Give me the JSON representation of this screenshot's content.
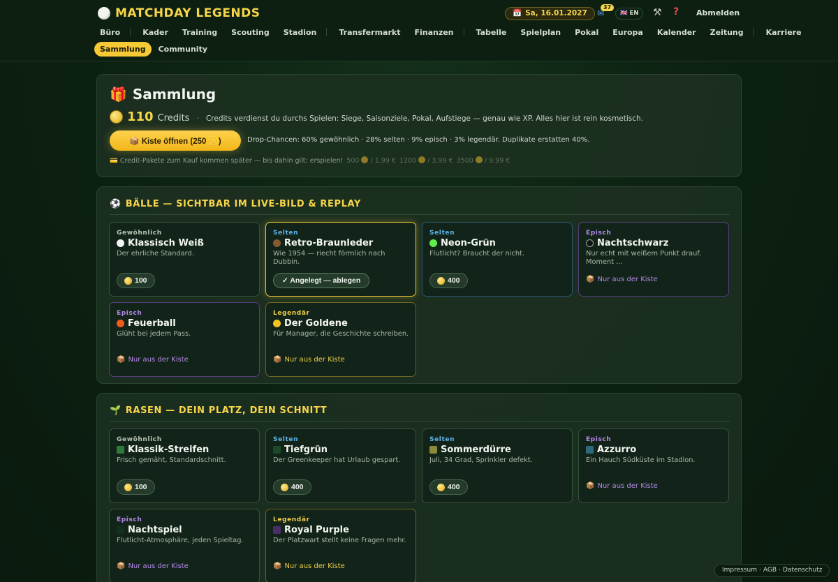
{
  "header": {
    "app_title": "MATCHDAY LEGENDS",
    "date": "Sa, 16.01.2027",
    "mail_count": "37",
    "language": "EN",
    "logout": "Abmelden",
    "nav": [
      "Büro",
      "Kader",
      "Training",
      "Scouting",
      "Stadion",
      "Transfermarkt",
      "Finanzen",
      "Tabelle",
      "Spielplan",
      "Pokal",
      "Europa",
      "Kalender",
      "Zeitung",
      "Karriere"
    ],
    "nav2_active": "Sammlung",
    "nav2_other": "Community"
  },
  "summary": {
    "title": "Sammlung",
    "credits": "110",
    "credits_unit": "Credits",
    "credits_note": "Credits verdienst du durchs Spielen: Siege, Saisonziele, Pokal, Aufstiege — genau wie XP. Alles hier ist rein kosmetisch.",
    "open_button": "📦 Kiste öffnen (250 🪙)",
    "drop_info": "Drop-Chancen: 60% gewöhnlich · 28% selten · 9% episch · 3% legendär. Duplikate erstatten 40%.",
    "packs_note": "💳 Credit-Pakete zum Kauf kommen später — bis dahin gilt: erspielen!",
    "packs": [
      {
        "amount": "500",
        "price": "/ 1,99 €"
      },
      {
        "amount": "1200",
        "price": "/ 3,99 €"
      },
      {
        "amount": "3500",
        "price": "/ 9,99 €"
      }
    ]
  },
  "balls": {
    "title": "BÄLLE — SICHTBAR IM LIVE-BILD & REPLAY",
    "items": [
      {
        "rarity": "Gewöhnlich",
        "name": "Klassisch Weiß",
        "desc": "Der ehrliche Standard.",
        "price": "100",
        "color": "#f4f4f0"
      },
      {
        "rarity": "Selten",
        "name": "Retro-Braunleder",
        "desc": "Wie 1954 — riecht förmlich nach Dubbin.",
        "equipped_label": "✓ Angelegt — ablegen",
        "color": "#8a5a2e"
      },
      {
        "rarity": "Selten",
        "name": "Neon-Grün",
        "desc": "Flutlicht? Braucht der nicht.",
        "price": "400",
        "color": "#5ef04a"
      },
      {
        "rarity": "Episch",
        "name": "Nachtschwarz",
        "desc": "Nur echt mit weißem Punkt drauf. Moment …",
        "crate_label": "Nur aus der Kiste",
        "color": "#111411"
      },
      {
        "rarity": "Episch",
        "name": "Feuerball",
        "desc": "Glüht bei jedem Pass.",
        "crate_label": "Nur aus der Kiste",
        "color": "#f05a1e"
      },
      {
        "rarity": "Legendär",
        "name": "Der Goldene",
        "desc": "Für Manager, die Geschichte schreiben.",
        "crate_label": "Nur aus der Kiste",
        "color": "#f2c21e"
      }
    ]
  },
  "lawn": {
    "title": "RASEN — DEIN PLATZ, DEIN SCHNITT",
    "items": [
      {
        "rarity": "Gewöhnlich",
        "name": "Klassik-Streifen",
        "desc": "Frisch gemäht, Standardschnitt.",
        "price": "100",
        "color": "#2f7a3a"
      },
      {
        "rarity": "Selten",
        "name": "Tiefgrün",
        "desc": "Der Greenkeeper hat Urlaub gespart.",
        "price": "400",
        "color": "#1c4a26"
      },
      {
        "rarity": "Selten",
        "name": "Sommerdürre",
        "desc": "Juli, 34 Grad, Sprinkler defekt.",
        "price": "400",
        "color": "#8a8a3a"
      },
      {
        "rarity": "Episch",
        "name": "Azzurro",
        "desc": "Ein Hauch Südküste im Stadion.",
        "crate_label": "Nur aus der Kiste",
        "color": "#2e6a7a"
      },
      {
        "rarity": "Episch",
        "name": "Nachtspiel",
        "desc": "Flutlicht-Atmosphäre, jeden Spieltag.",
        "crate_label": "Nur aus der Kiste",
        "color": "#13301c"
      },
      {
        "rarity": "Legendär",
        "name": "Royal Purple",
        "desc": "Der Platzwart stellt keine Fragen mehr.",
        "crate_label": "Nur aus der Kiste",
        "color": "#4a2e6a"
      }
    ]
  },
  "footer": {
    "impressum": "Impressum",
    "agb": "AGB",
    "datenschutz": "Datenschutz"
  },
  "colors": {
    "accent": "#f7d54a",
    "selten": "#5db4ea",
    "episch": "#b588ea",
    "legendaer": "#f2cf48"
  }
}
